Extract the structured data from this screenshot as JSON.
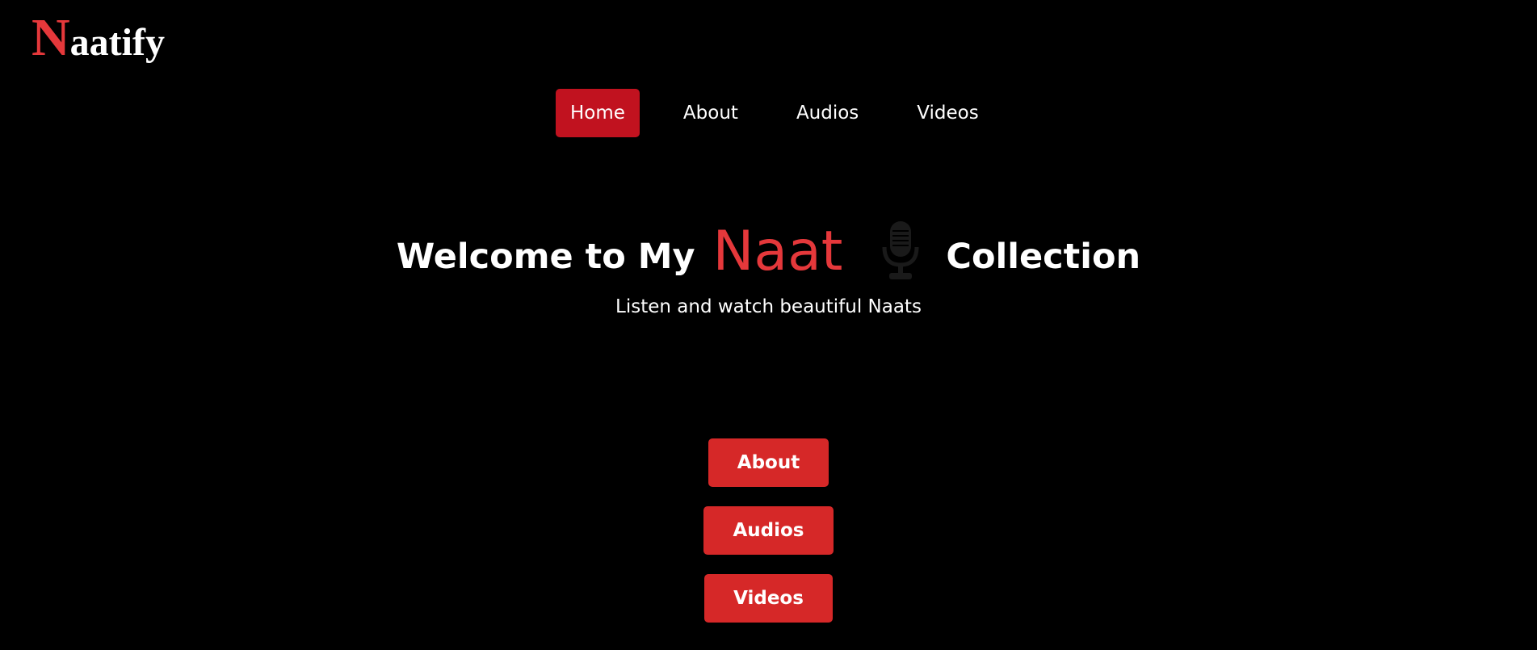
{
  "brand": {
    "initial": "N",
    "rest": "aatify"
  },
  "nav": {
    "items": [
      {
        "label": "Home",
        "active": true
      },
      {
        "label": "About",
        "active": false
      },
      {
        "label": "Audios",
        "active": false
      },
      {
        "label": "Videos",
        "active": false
      }
    ]
  },
  "hero": {
    "title_before": "Welcome to My",
    "title_accent": "Naat",
    "title_after": "Collection",
    "icon": "microphone-icon",
    "subtitle": "Listen and watch beautiful Naats"
  },
  "actions": {
    "about_label": "About",
    "audios_label": "Audios",
    "videos_label": "Videos"
  },
  "colors": {
    "background": "#000000",
    "accent": "#e5383b",
    "nav_active": "#c1121f",
    "button": "#d62828",
    "text": "#ffffff"
  }
}
